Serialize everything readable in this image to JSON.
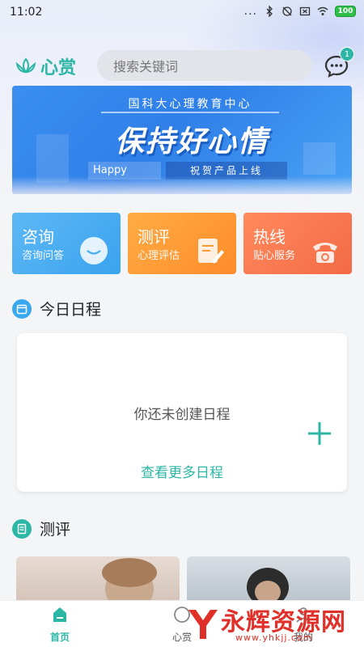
{
  "status_bar": {
    "time": "11:02",
    "signal_dots": "...",
    "battery": "100"
  },
  "header": {
    "logo_text": "心赏",
    "search_placeholder": "搜索关键词",
    "message_badge": "1"
  },
  "banner": {
    "top_text": "国科大心理教育中心",
    "title": "保持好心情",
    "happy": "Happy",
    "subtitle": "祝贺产品上线"
  },
  "services": [
    {
      "title": "咨询",
      "subtitle": "咨询问答",
      "icon": "smile-icon"
    },
    {
      "title": "测评",
      "subtitle": "心理评估",
      "icon": "clipboard-pen-icon"
    },
    {
      "title": "热线",
      "subtitle": "贴心服务",
      "icon": "telephone-icon"
    }
  ],
  "schedule": {
    "section_title": "今日日程",
    "empty_text": "你还未创建日程",
    "more_link": "查看更多日程"
  },
  "evaluation": {
    "section_title": "测评"
  },
  "bottom_nav": [
    {
      "label": "首页",
      "icon": "home-icon",
      "active": true
    },
    {
      "label": "心赏",
      "icon": "heart-icon",
      "active": false
    },
    {
      "label": "我的",
      "icon": "person-icon",
      "active": false
    }
  ],
  "watermark": {
    "text": "永辉资源网",
    "url": "www.yhkjj.com"
  },
  "colors": {
    "accent": "#2cb6a6",
    "consult": "#4aaef2",
    "eval": "#ff9a33",
    "hotline": "#f77a50"
  }
}
